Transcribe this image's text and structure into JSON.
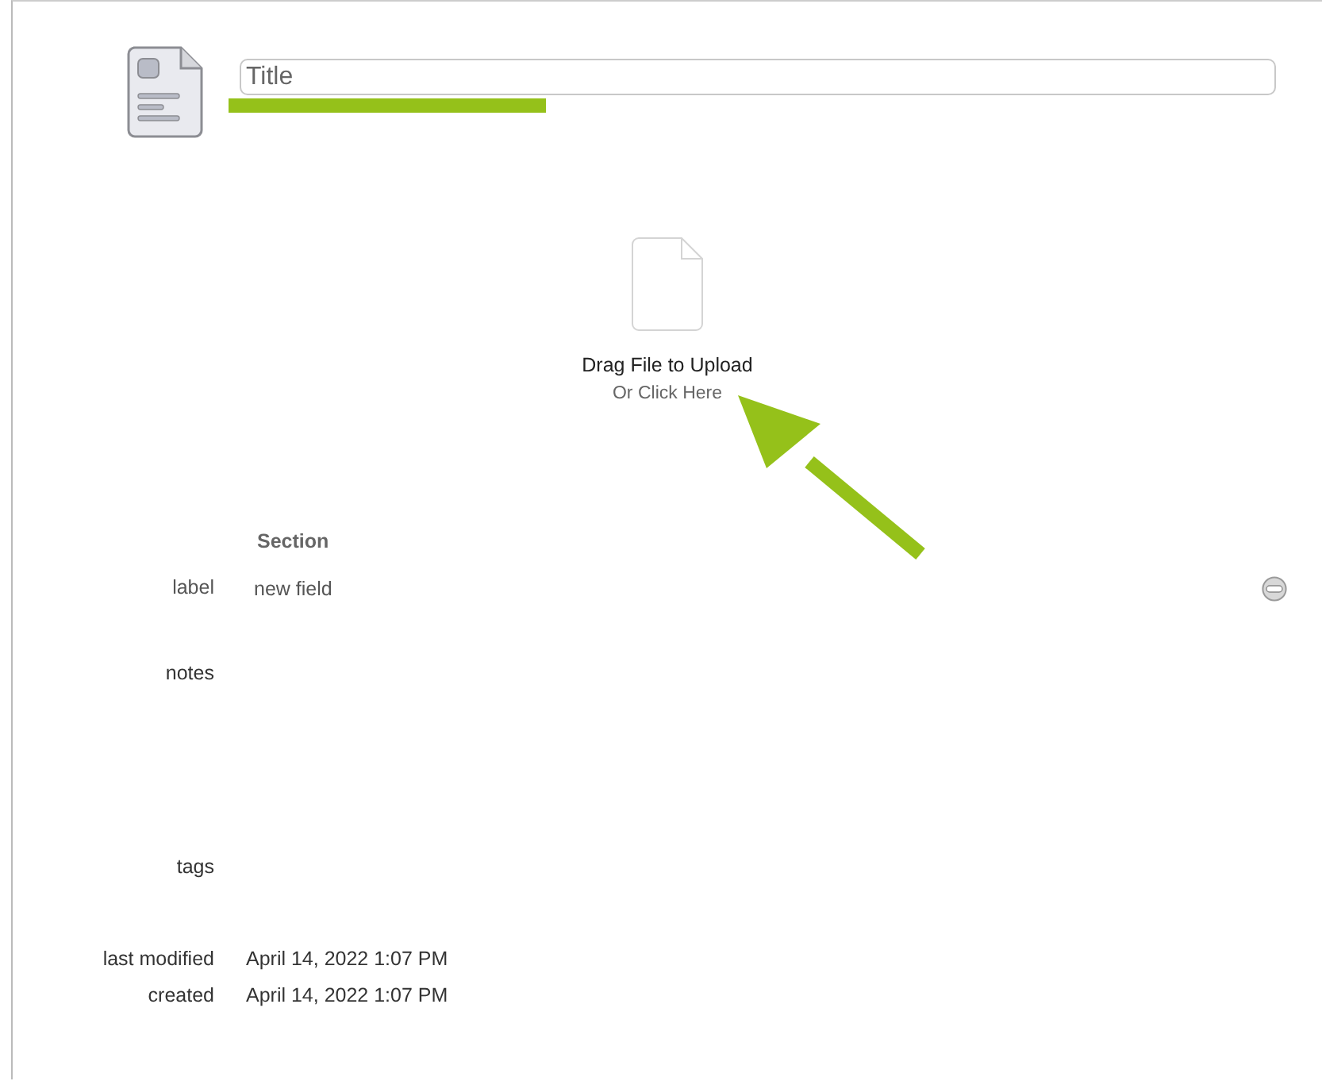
{
  "title_field": {
    "placeholder": "Title"
  },
  "upload": {
    "heading": "Drag File to Upload",
    "subheading": "Or Click Here"
  },
  "section": {
    "title": "Section"
  },
  "rows": [
    {
      "kind": "field",
      "label": "label",
      "value": "new field"
    },
    {
      "kind": "notes",
      "label": "notes"
    },
    {
      "kind": "tags",
      "label": "tags"
    },
    {
      "kind": "meta",
      "label": "last modified",
      "value": "April 14, 2022 1:07 PM"
    },
    {
      "kind": "meta",
      "label": "created",
      "value": "April 14, 2022 1:07 PM"
    }
  ]
}
